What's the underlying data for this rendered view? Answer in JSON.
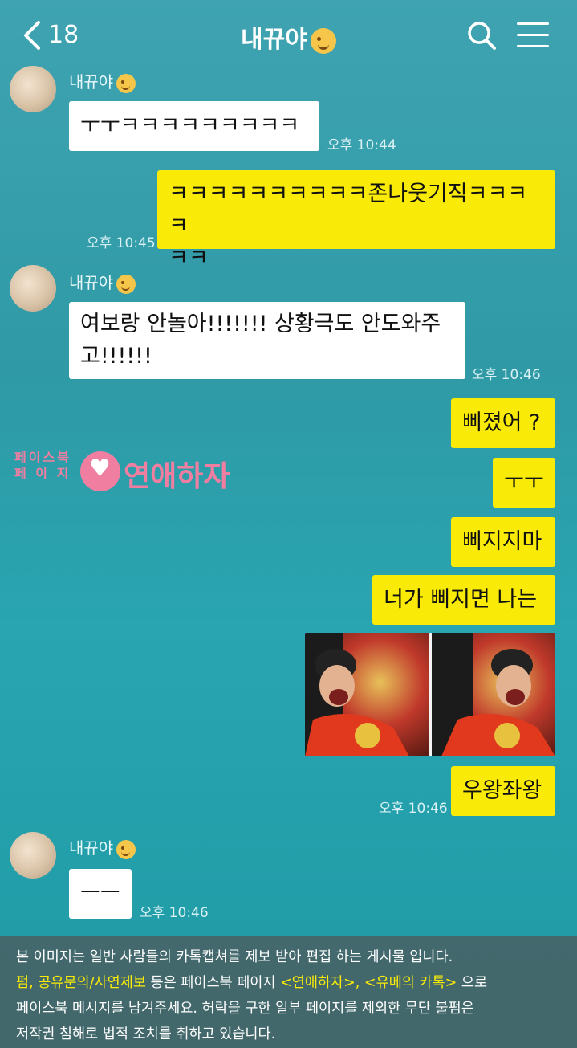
{
  "header": {
    "back_count": "18",
    "title": "내뀨야"
  },
  "messages": {
    "m1_sender": "내뀨야",
    "m1_text": "ㅜㅜㅋㅋㅋㅋㅋㅋㅋㅋㅋ",
    "m1_time": "오후 10:44",
    "m2_text_line1": "ㅋㅋㅋㅋㅋㅋㅋㅋㅋㅋ존나웃기직ㅋㅋㅋㅋ",
    "m2_text_line2": "ㅋㅋ",
    "m2_time": "오후 10:45",
    "m3_sender": "내뀨야",
    "m3_text_line1": "여보랑 안놀아!!!!!!! 상황극도 안도와주",
    "m3_text_line2": "고!!!!!!",
    "m3_time": "오후 10:46",
    "m4_text": "삐졌어 ?",
    "m5_text": "ㅜㅜ",
    "m6_text": "삐지지마",
    "m7_text": "너가 삐지면 나는",
    "m9_text": "우왕좌왕",
    "m9_time": "오후 10:46",
    "m10_sender": "내뀨야",
    "m10_text": "ㅡㅡ",
    "m10_time": "오후 10:46"
  },
  "watermark": {
    "line1": "페이스북",
    "line2": "페 이 지",
    "brand": "연애하자"
  },
  "notice": {
    "line1": "본 이미지는 일반 사람들의 카톡캡쳐를 제보 받아 편집 하는 게시물 입니다.",
    "line2_hl1": "펌, 공유문의/사연제보",
    "line2_mid": " 등은 페이스북 페이지 ",
    "line2_hl2": "<연애하자>, <유메의 카톡>",
    "line2_end": " 으로",
    "line3": "페이스북 메시지를 남겨주세요. 허락을 구한 일부 페이지를 제외한 무단 불펌은",
    "line4": "저작권 침해로 법적 조치를 취하고 있습니다."
  },
  "colors": {
    "background": "#2fa0ac",
    "my_bubble": "#f9eb07",
    "their_bubble": "#ffffff",
    "watermark": "#f07ea0"
  }
}
